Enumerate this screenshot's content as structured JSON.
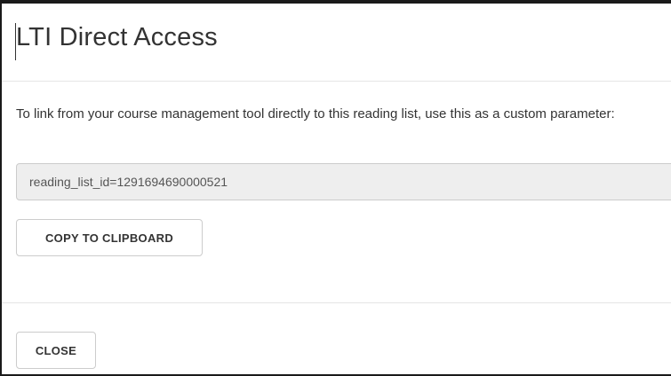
{
  "dialog": {
    "title": "LTI Direct Access",
    "instruction": "To link from your course management tool directly to this reading list, use this as a custom parameter:",
    "parameter_value": "reading_list_id=1291694690000521",
    "copy_button_label": "COPY TO CLIPBOARD",
    "close_button_label": "CLOSE"
  }
}
